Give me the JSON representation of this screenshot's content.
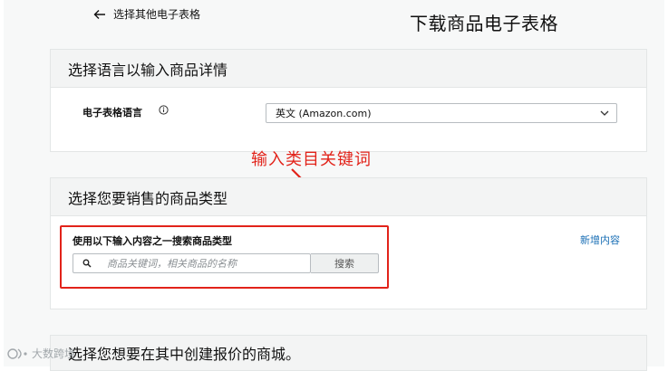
{
  "header": {
    "back_label": "选择其他电子表格",
    "title": "下载商品电子表格"
  },
  "language_section": {
    "heading": "选择语言以输入商品详情",
    "field_label": "电子表格语言",
    "selected_value": "英文 (Amazon.com)"
  },
  "annotation": {
    "text": "输入类目关键词",
    "color": "#e2231a"
  },
  "product_type_section": {
    "heading": "选择您要销售的商品类型",
    "search_heading": "使用以下输入内容之一搜索商品类型",
    "search_placeholder": "商品关键词，相关商品的名称",
    "search_button": "搜索",
    "add_link": "新增内容"
  },
  "marketplace_section": {
    "heading": "选择您想要在其中创建报价的商城。"
  },
  "watermark": {
    "text": "大数跨境"
  },
  "colors": {
    "link": "#1a6fb5",
    "highlight": "#e2231a",
    "section_header_bg": "#f3f4f4"
  },
  "icons": [
    "arrow-left-icon",
    "info-icon",
    "chevron-down-icon",
    "search-icon"
  ]
}
